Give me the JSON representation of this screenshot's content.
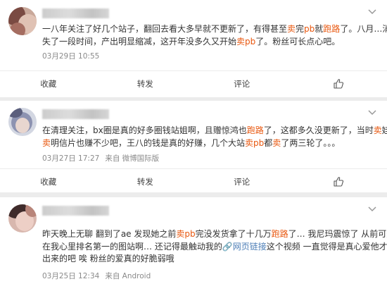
{
  "posts": [
    {
      "text_segments": [
        [
          {
            "t": "一八年关注了好几个站子，翻回去看大多早就不更新了，有得甚至"
          },
          {
            "t": "卖",
            "hl": true
          },
          {
            "t": "完"
          },
          {
            "t": "pb",
            "hl": true
          },
          {
            "t": "就"
          },
          {
            "t": "跑路",
            "hl": true
          },
          {
            "t": "了。八月…消"
          }
        ],
        [
          {
            "t": "失了一段时间，产出明显缩减，这开年没多久又开始"
          },
          {
            "t": "卖pb",
            "hl": true
          },
          {
            "t": "了。粉丝可长点心吧。"
          }
        ]
      ],
      "time": "03月29日 10:55",
      "source": ""
    },
    {
      "text_segments": [
        [
          {
            "t": "在清理关注，bx圈是真的好多圈钱站姐啊，且赠惊鸿也"
          },
          {
            "t": "跑路",
            "hl": true
          },
          {
            "t": "了，这都多久没更新了，当时"
          },
          {
            "t": "卖",
            "hl": true
          },
          {
            "t": "娃"
          }
        ],
        [
          {
            "t": "卖",
            "hl": true
          },
          {
            "t": "明信片也赚不少吧，王八的钱是真的好赚，几个大站"
          },
          {
            "t": "卖pb",
            "hl": true
          },
          {
            "t": "都"
          },
          {
            "t": "卖",
            "hl": true
          },
          {
            "t": "了两三轮了。。。"
          }
        ]
      ],
      "time": "03月27日 17:27",
      "source": "来自 微博国际版"
    },
    {
      "text_segments": [
        [
          {
            "t": "昨天晚上无聊 翻到了ae 发现她之前"
          },
          {
            "t": "卖pb",
            "hl": true
          },
          {
            "t": "完没发货拿了十几万"
          },
          {
            "t": "跑路",
            "hl": true
          },
          {
            "t": "了… 我尼玛震惊了 从前可是"
          }
        ],
        [
          {
            "t": "在我心里排名第一的图站啊… 还记得最触动我的"
          },
          {
            "t": "🔗网页链接",
            "link": true
          },
          {
            "t": "这个视频 一直觉得是真心爱他才能拍"
          }
        ],
        [
          {
            "t": "出来的吧 唉 粉丝的爱真的好脆弱哦"
          }
        ]
      ],
      "time": "03月25日 12:34",
      "source": "来自 Android"
    }
  ],
  "actions": {
    "favorite": "收藏",
    "repost": "转发",
    "comment": "评论"
  },
  "colors": {
    "highlight": "#e8560d",
    "link": "#4b7db6",
    "meta": "#8a8a8a"
  }
}
